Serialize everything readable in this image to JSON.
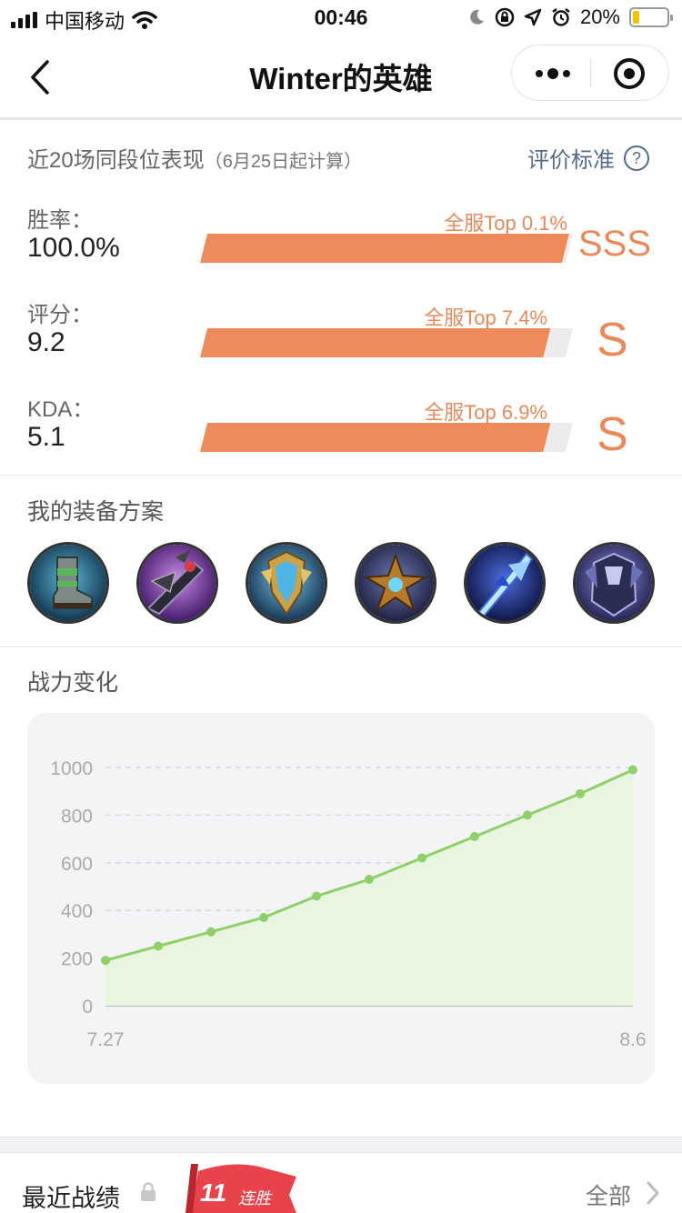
{
  "status_bar": {
    "carrier": "中国移动",
    "time": "00:46",
    "battery": "20%",
    "battery_level": 0.2
  },
  "nav": {
    "title": "Winter的英雄"
  },
  "performance": {
    "heading": "近20场同段位表现",
    "subheading": "（6月25日起计算）",
    "criteria_label": "评价标准",
    "criteria_icon": "?",
    "stats": [
      {
        "label": "胜率：",
        "value": "100.0%",
        "rank": "全服Top 0.1%",
        "grade": "SSS",
        "percentile_fill": 0.99
      },
      {
        "label": "评分：",
        "value": "9.2",
        "rank": "全服Top 7.4%",
        "grade": "S",
        "percentile_fill": 0.94
      },
      {
        "label": "KDA：",
        "value": "5.1",
        "rank": "全服Top 6.9%",
        "grade": "S",
        "percentile_fill": 0.94
      }
    ]
  },
  "equipment": {
    "heading": "我的装备方案",
    "items": [
      {
        "icon": "boots-icon"
      },
      {
        "icon": "dark-blade-icon"
      },
      {
        "icon": "golden-shield-icon"
      },
      {
        "icon": "spiked-crest-icon"
      },
      {
        "icon": "ice-spear-icon"
      },
      {
        "icon": "dark-armor-icon"
      }
    ]
  },
  "power": {
    "heading": "战力变化"
  },
  "chart_data": {
    "type": "area",
    "x": [
      "7.27",
      "",
      "",
      "",
      "",
      "",
      "",
      "",
      "",
      "",
      "8.6"
    ],
    "values": [
      190,
      250,
      310,
      370,
      460,
      530,
      620,
      710,
      800,
      890,
      990
    ],
    "ylim": [
      0,
      1000
    ],
    "yticks": [
      0,
      200,
      400,
      600,
      800,
      1000
    ],
    "xtick_labels": [
      "7.27",
      "8.6"
    ],
    "grid": true,
    "colors": {
      "line": "#8fd06a",
      "fill": "#e8f5df",
      "grid": "#d9d9de",
      "tick": "#aaaaaa"
    }
  },
  "recent": {
    "heading": "最近战绩",
    "streak_count": "11",
    "streak_label": "连胜",
    "all_label": "全部"
  },
  "colors": {
    "accent": "#ef8a5a",
    "grade": "#e8895a",
    "link": "#556a8a"
  }
}
